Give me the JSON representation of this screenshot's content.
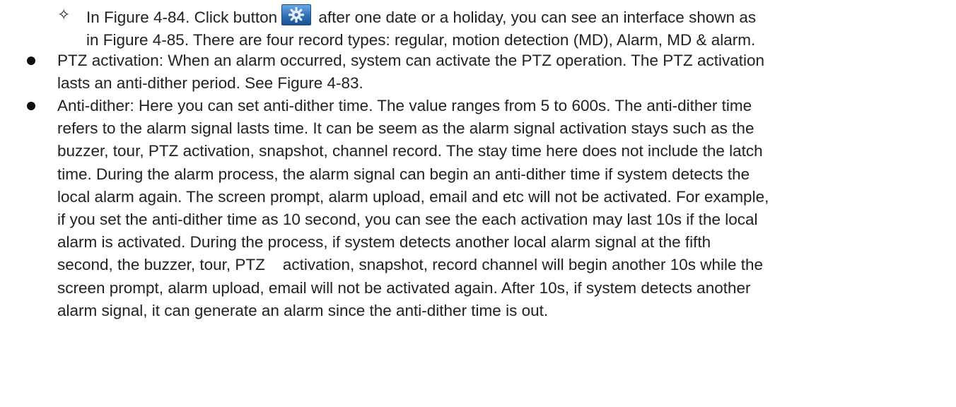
{
  "sub_item": {
    "text_before": "In Figure 4-84. Click button",
    "text_after": " after one date or a holiday, you can see an interface shown as",
    "line2": "in Figure 4-85. There are four record types: regular, motion detection (MD), Alarm, MD & alarm.",
    "icon": "gear-icon"
  },
  "bullets": [
    {
      "lines": [
        "PTZ activation: When an alarm occurred, system can activate the PTZ operation. The PTZ activation",
        "lasts an anti-dither period. See Figure 4-83."
      ]
    },
    {
      "lines": [
        "Anti-dither: Here you can set anti-dither time. The value ranges from 5 to 600s. The anti-dither time",
        "refers to the alarm signal lasts time. It can be seem as the alarm signal activation stays such as the",
        "buzzer, tour, PTZ activation, snapshot, channel record. The stay time here does not include the latch",
        "time. During the alarm process, the alarm signal can begin an anti-dither time if system detects the",
        "local alarm again. The screen prompt, alarm upload, email and etc will not be activated. For example,",
        "if you set the anti-dither time as 10 second, you can see the each activation may last 10s if the local",
        "alarm is activated. During the process, if system detects another local alarm signal at the fifth",
        "second, the buzzer, tour, PTZ    activation, snapshot, record channel will begin another 10s while the",
        "screen prompt, alarm upload, email will not be activated again. After 10s, if system detects another",
        "alarm signal, it can generate an alarm since the anti-dither time is out."
      ]
    }
  ]
}
